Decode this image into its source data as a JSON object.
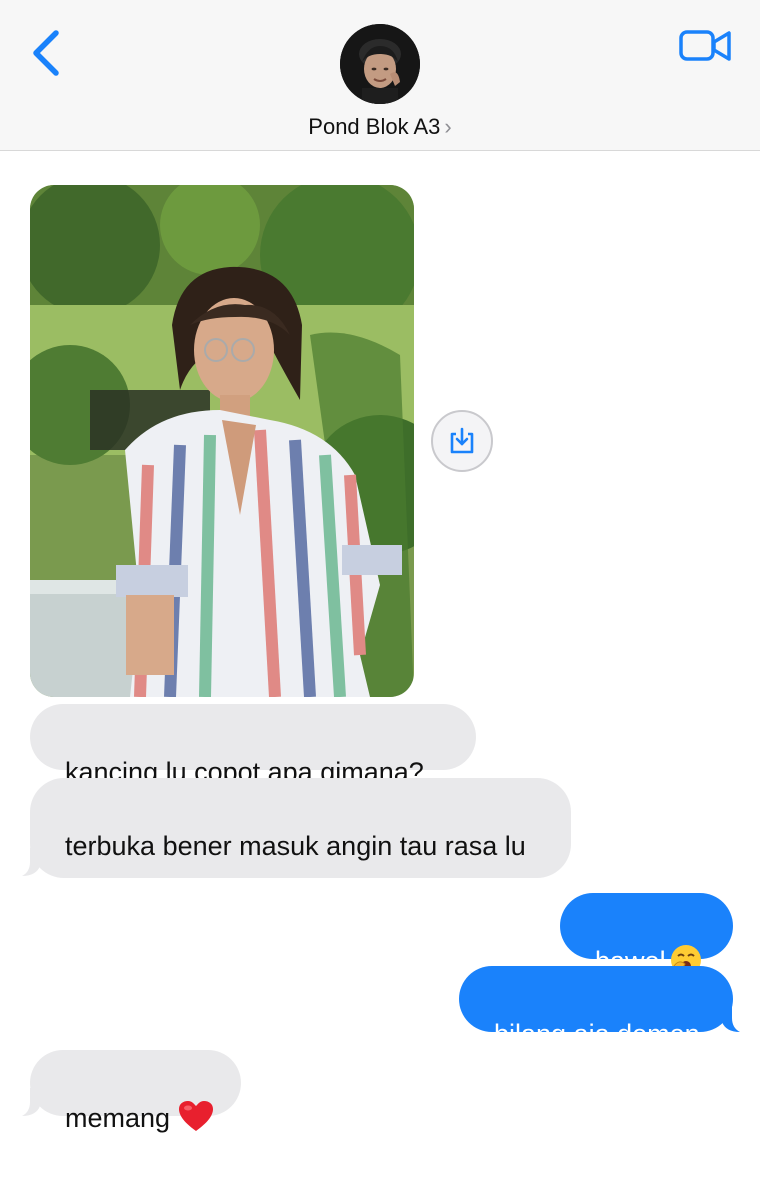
{
  "header": {
    "contact_name": "Pond Blok A3",
    "chevron": "›",
    "back_icon": "chevron-left-icon",
    "video_icon": "video-camera-icon",
    "accent_color": "#1a82fb"
  },
  "thread": {
    "photo_alt": "Photo of a person in a striped shirt",
    "save_icon": "download-icon",
    "messages": [
      {
        "direction": "incoming",
        "text": "kancing lu copot apa gimana?"
      },
      {
        "direction": "incoming",
        "text": "terbuka bener masuk angin tau rasa lu"
      },
      {
        "direction": "outgoing",
        "text": "bawel",
        "emoji": "yawning-face-emoji"
      },
      {
        "direction": "outgoing",
        "text": "bilang aja demen"
      },
      {
        "direction": "incoming",
        "text": "memang",
        "emoji": "red-heart-emoji"
      }
    ]
  },
  "colors": {
    "incoming_bubble": "#e9e9eb",
    "outgoing_bubble": "#1a82fb"
  }
}
